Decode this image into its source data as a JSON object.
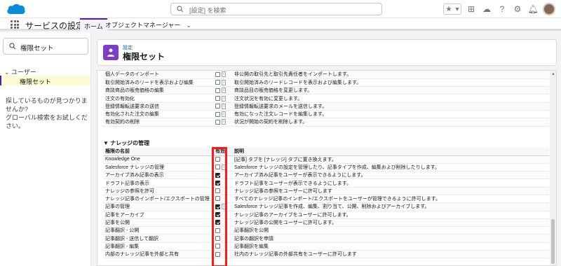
{
  "header": {
    "search_placeholder": "[設定] を検索"
  },
  "nav": {
    "app_name": "サービスの設定",
    "tabs": [
      {
        "label": "ホーム"
      },
      {
        "label": "オブジェクトマネージャー"
      }
    ]
  },
  "sidebar": {
    "quick_find_value": "権限セット",
    "tree_section": "ユーザー",
    "tree_item": "権限セット",
    "help_line1": "探しているものが見つかりませんか?",
    "help_line2": "グローバル検索をお試しください。"
  },
  "page_header": {
    "breadcrumb": "設定",
    "title": "権限セット"
  },
  "upper_rows": [
    {
      "name": "個人データのインポート",
      "enabled": false,
      "info": true,
      "desc": "非公開の取引先と取引先責任者をインポートします。"
    },
    {
      "name": "取引開始済みのリードを表示および編集",
      "enabled": false,
      "info": true,
      "desc": "取引開始済みのリードレコードを表示および編集します。"
    },
    {
      "name": "商談商品の販売価格の編集",
      "enabled": false,
      "info": true,
      "desc": "商談品目の販売価格を変更します。"
    },
    {
      "name": "注文の有効化",
      "enabled": false,
      "info": true,
      "desc": "注文状況を有効に変更します。"
    },
    {
      "name": "登録情報転送要求の送信",
      "enabled": false,
      "info": true,
      "desc": "登録情報転送要求のメールを送信します。"
    },
    {
      "name": "有効化された注文の編集",
      "enabled": false,
      "info": true,
      "desc": "有効になった注文レコードを編集します。"
    },
    {
      "name": "有効契約の削除",
      "enabled": false,
      "info": true,
      "desc": "状況が開始の契約を削除します。"
    }
  ],
  "knowledge": {
    "section_title": "ナレッジの管理",
    "col_name": "権限の名前",
    "col_enabled": "有効",
    "col_desc": "説明",
    "rows": [
      {
        "name": "Knowledge One",
        "enabled": false,
        "info": false,
        "desc": "[記事] タブを [ナレッジ] タブに置き換えます。"
      },
      {
        "name": "Salesforce ナレッジの管理",
        "enabled": false,
        "info": true,
        "desc": "Salesforce ナレッジの設定を管理したり、記事タイプを作成、編集および削除したりします。"
      },
      {
        "name": "アーカイブ済み記事の表示",
        "enabled": true,
        "info": false,
        "desc": "アーカイブ済み記事をユーザーが表示できるようにします。"
      },
      {
        "name": "ドラフト記事の表示",
        "enabled": true,
        "info": false,
        "desc": "ドラフト記事をユーザーが表示できるようにします。"
      },
      {
        "name": "ナレッジの参照を許可",
        "enabled": false,
        "info": false,
        "desc": "ナレッジ記事の参照をユーザーに許可します"
      },
      {
        "name": "ナレッジ記事のインポート/エクスポートの管理",
        "enabled": false,
        "info": false,
        "desc": "すべてのナレッジ記事のインポート/エクスポートをユーザーが管理できるように許可します。"
      },
      {
        "name": "記事の管理",
        "enabled": true,
        "info": true,
        "desc": "Salesforce ナレッジ記事を作成、編集、割り当て、公開、削除およびアーカイブします。"
      },
      {
        "name": "記事をアーカイブ",
        "enabled": true,
        "info": false,
        "desc": "ナレッジ記事のアーカイブをユーザーに許可します。"
      },
      {
        "name": "記事を公開",
        "enabled": true,
        "info": false,
        "desc": "ナレッジ記事の公開をユーザーに許可します。"
      },
      {
        "name": "記事翻訳 - 公開",
        "enabled": false,
        "info": false,
        "desc": "記事翻訳を公開"
      },
      {
        "name": "記事翻訳 - 送信して翻訳",
        "enabled": false,
        "info": false,
        "desc": "記事の翻訳を申請"
      },
      {
        "name": "記事翻訳 - 編集",
        "enabled": false,
        "info": false,
        "desc": "記事翻訳を編集"
      },
      {
        "name": "内部のナレッジ記事を外部と共有",
        "enabled": false,
        "info": false,
        "desc": "社内のナレッジ記事の外部共有をユーザーに許可します"
      }
    ]
  },
  "colors": {
    "accent": "#5a1ba9",
    "highlight": "#ff1a1a",
    "brand": "#0b8bd8"
  }
}
